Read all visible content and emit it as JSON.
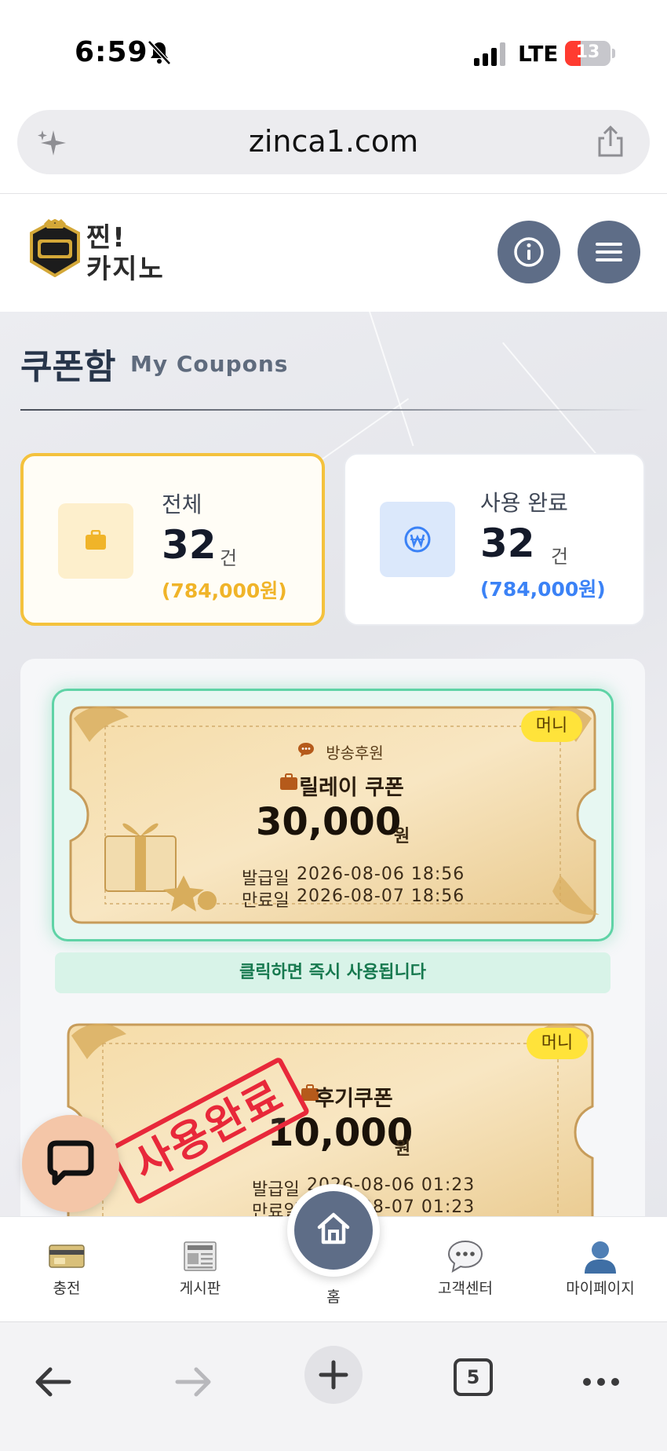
{
  "status_bar": {
    "time": "6:59",
    "network": "LTE",
    "battery": "13",
    "battery_level_percent": 13
  },
  "browser": {
    "url": "zinca1.com",
    "tabs_count": "5"
  },
  "site": {
    "logo_line1": "찐!",
    "logo_line2": "카지노",
    "info_icon": "info-icon",
    "menu_icon": "hamburger-menu-icon"
  },
  "page": {
    "title": "쿠폰함",
    "subtitle": "My Coupons"
  },
  "summary": [
    {
      "label": "전체",
      "count": "32",
      "unit": "건",
      "amount": "(784,000원)",
      "icon": "briefcase-icon",
      "accent": "#f0b429"
    },
    {
      "label": "사용 완료",
      "count": "32",
      "unit": "건",
      "amount": "(784,000원)",
      "icon": "won-coin-icon",
      "accent": "#3b82f6"
    }
  ],
  "coupons": [
    {
      "tag": "머니",
      "source": "방송후원",
      "name": "릴레이 쿠폰",
      "amount": "30,000",
      "currency": "원",
      "issued_label": "발급일",
      "issued": "2026-08-06 18:56",
      "expires_label": "만료일",
      "expires": "2026-08-07 18:56",
      "hint": "클릭하면 즉시 사용됩니다"
    },
    {
      "tag": "머니",
      "name": "후기쿠폰",
      "amount": "10,000",
      "currency": "원",
      "issued_label": "발급일",
      "issued": "2026-08-06 01:23",
      "expires_label": "만료일",
      "expires": "2026-08-07 01:23",
      "stamp": "사용완료"
    }
  ],
  "bottom_nav": {
    "items": [
      {
        "label": "충전",
        "icon": "credit-card-icon"
      },
      {
        "label": "게시판",
        "icon": "newspaper-icon"
      },
      {
        "label": "홈",
        "icon": "home-icon"
      },
      {
        "label": "고객센터",
        "icon": "speech-bubble-icon"
      },
      {
        "label": "마이페이지",
        "icon": "user-icon"
      }
    ]
  },
  "colors": {
    "accent_gold": "#f4c23d",
    "accent_blue": "#3b82f6",
    "nav_slate": "#5e6d87",
    "success_green": "#17794f",
    "stamp_red": "#e8283a"
  }
}
